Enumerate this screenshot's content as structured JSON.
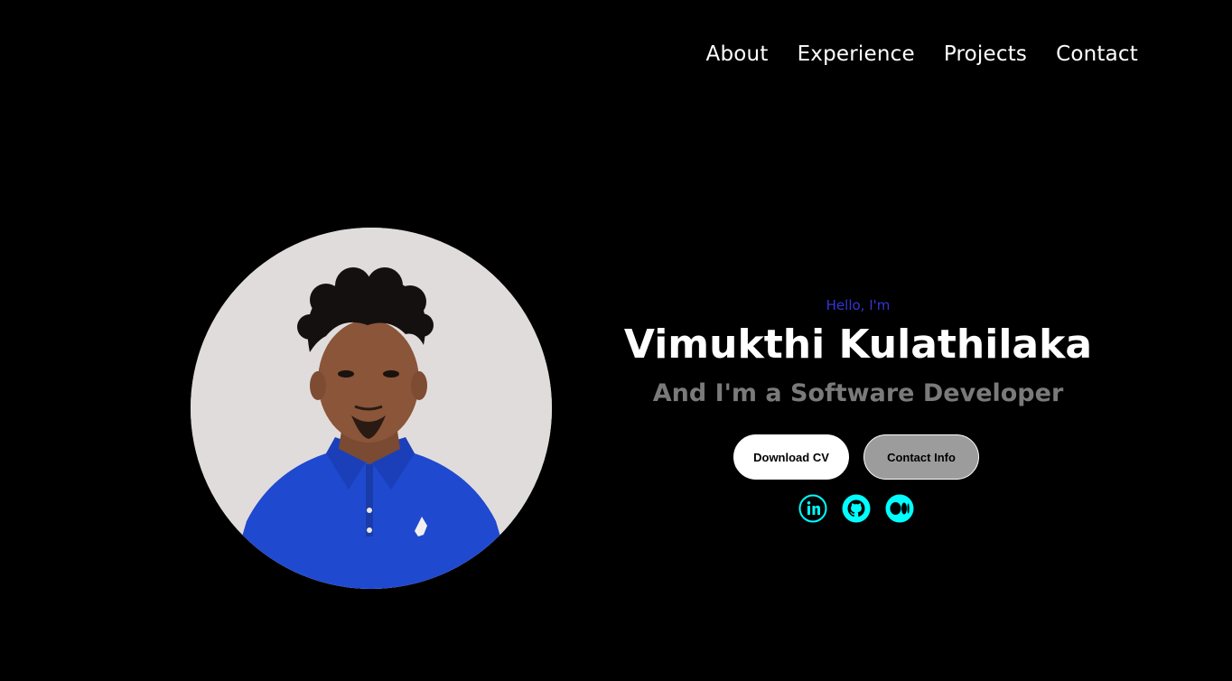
{
  "nav": {
    "items": [
      {
        "label": "About"
      },
      {
        "label": "Experience"
      },
      {
        "label": "Projects"
      },
      {
        "label": "Contact"
      }
    ]
  },
  "hero": {
    "greeting": "Hello, I'm",
    "name": "Vimukthi Kulathilaka",
    "role": "And I'm a Software Developer",
    "buttons": {
      "download_cv": "Download CV",
      "contact_info": "Contact Info"
    },
    "photo_alt": "Profile picture"
  },
  "socials": [
    {
      "icon": "linkedin-icon"
    },
    {
      "icon": "github-icon"
    },
    {
      "icon": "medium-icon"
    }
  ],
  "colors": {
    "background": "#000000",
    "greeting": "#3535d6",
    "role": "#7a7a7a",
    "accent_icon": "#00ffff",
    "button_secondary": "#9c9c9c"
  }
}
